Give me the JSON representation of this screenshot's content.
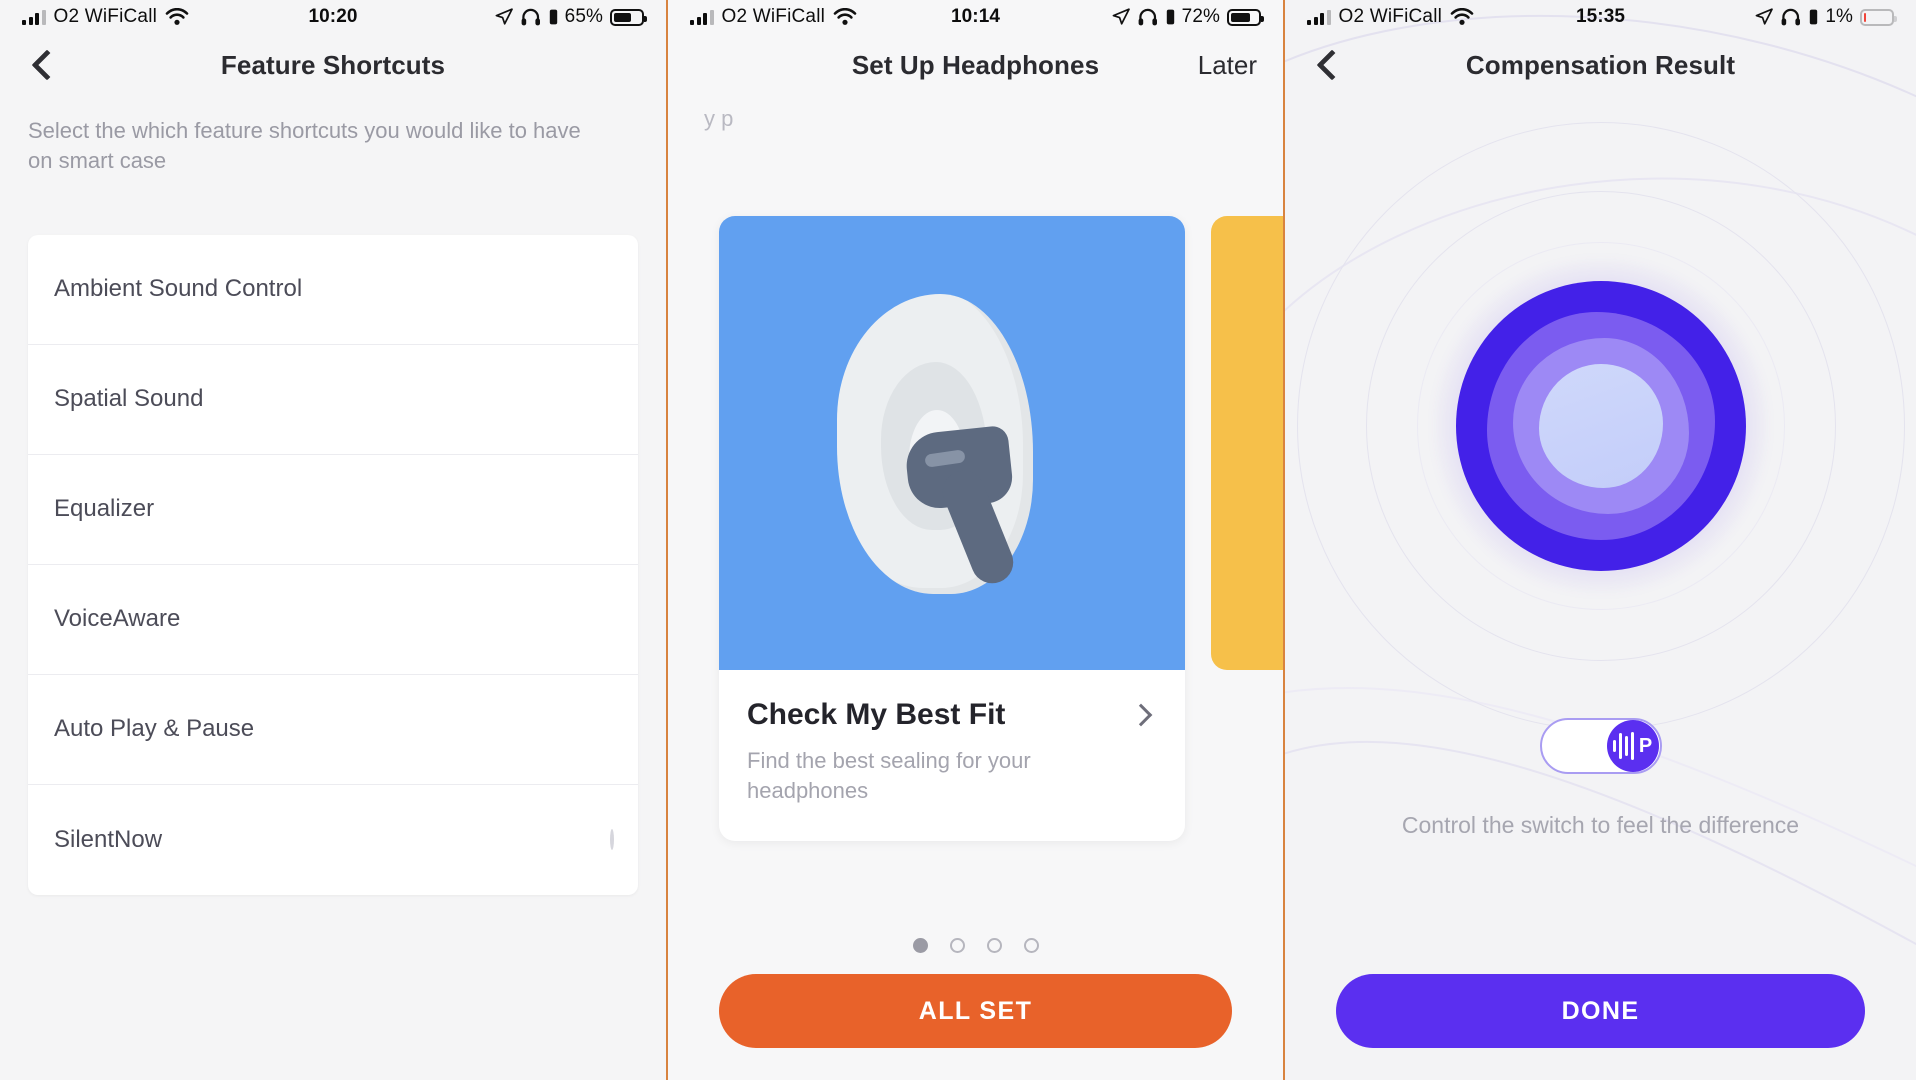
{
  "panel1": {
    "status": {
      "carrier": "O2 WiFiCall",
      "time": "10:20",
      "battery_percent": "65%",
      "icons": [
        "signal-bars-icon",
        "wifi-icon",
        "location-arrow-icon",
        "headphones-icon",
        "headphone-battery-icon",
        "battery-icon"
      ]
    },
    "nav": {
      "title": "Feature Shortcuts",
      "back": "back-chevron-icon"
    },
    "subtitle": "Select the which feature shortcuts you would like to have on smart case",
    "features": [
      {
        "label": "Ambient Sound Control",
        "checked": true
      },
      {
        "label": "Spatial Sound",
        "checked": true
      },
      {
        "label": "Equalizer",
        "checked": true
      },
      {
        "label": "VoiceAware",
        "checked": true
      },
      {
        "label": "Auto Play & Pause",
        "checked": true
      },
      {
        "label": "SilentNow",
        "checked": false
      }
    ]
  },
  "panel2": {
    "status": {
      "carrier": "O2 WiFiCall",
      "time": "10:14",
      "battery_percent": "72%"
    },
    "nav": {
      "title": "Set Up Headphones",
      "right_action": "Later"
    },
    "faded_text": "y          p",
    "slide": {
      "title": "Check My Best Fit",
      "subtitle": "Find the best sealing for your headphones",
      "art": "ear-with-earbud-illustration",
      "art_color": "#61a0f0",
      "peek_color": "#f6c04a"
    },
    "pagination": {
      "count": 4,
      "active_index": 0
    },
    "cta": {
      "label": "ALL SET",
      "color": "#e8622a"
    }
  },
  "panel3": {
    "status": {
      "carrier": "O2 WiFiCall",
      "time": "15:35",
      "battery_percent": "1%"
    },
    "nav": {
      "title": "Compensation Result"
    },
    "visual": {
      "name": "compensation-blob-visual",
      "layers": [
        "#4321e8",
        "#7b5cf0",
        "#9d89f5",
        "#cfd8fb"
      ]
    },
    "switch": {
      "state": "on",
      "knob_icon": "waveform-p-logo-icon"
    },
    "hint": "Control the switch to feel the difference",
    "cta": {
      "label": "DONE",
      "color": "#5b2ff0"
    }
  }
}
